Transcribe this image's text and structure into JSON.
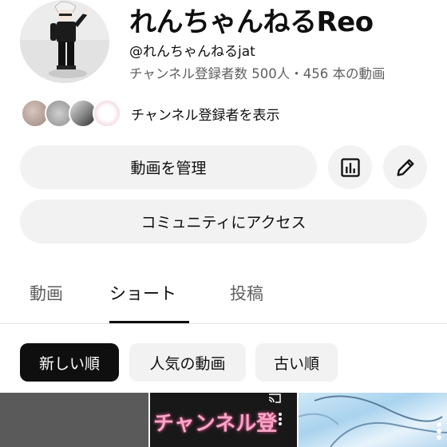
{
  "channel": {
    "name": "れんちゃんねるReo",
    "handle": "@れんちゃんねるjat",
    "stats": "チャンネル登録者数 500人・456 本の動画"
  },
  "subscribers": {
    "link_label": "チャンネル登録者を表示"
  },
  "buttons": {
    "manage_videos": "動画を管理",
    "community": "コミュニティにアクセス",
    "analytics_icon": "analytics-icon",
    "edit_icon": "pencil-icon"
  },
  "tabs": [
    {
      "label": "動画",
      "active": false
    },
    {
      "label": "ショート",
      "active": true
    },
    {
      "label": "投稿",
      "active": false
    }
  ],
  "chips": [
    {
      "label": "新しい順",
      "selected": true
    },
    {
      "label": "人気の動画",
      "selected": false
    },
    {
      "label": "古い順",
      "selected": false
    }
  ],
  "thumbnails": [
    {
      "overlay_text": ""
    },
    {
      "overlay_text": "チャンネル登"
    },
    {
      "overlay_text": ""
    }
  ]
}
